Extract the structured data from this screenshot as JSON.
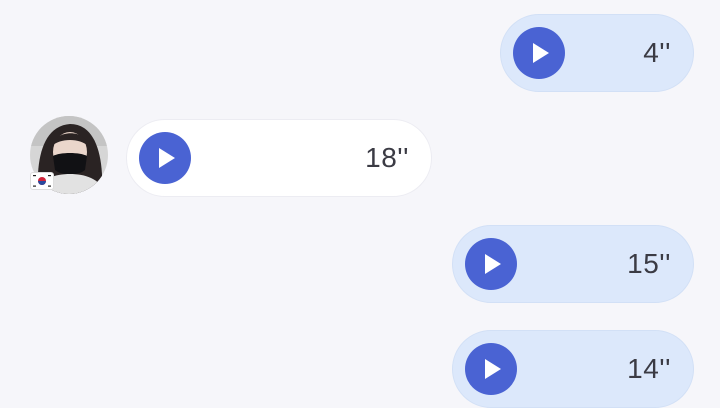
{
  "messages": [
    {
      "direction": "outgoing",
      "duration": "4''"
    },
    {
      "direction": "incoming",
      "duration": "18''"
    },
    {
      "direction": "outgoing",
      "duration": "15''"
    },
    {
      "direction": "outgoing",
      "duration": "14''"
    }
  ],
  "icons": {
    "play": "play-icon",
    "flag": "south-korea-flag-icon"
  },
  "colors": {
    "background": "#f6f6fa",
    "outgoing_bubble": "#dce8fb",
    "incoming_bubble": "#ffffff",
    "play_button": "#4a63d3",
    "duration_text": "#3b3b44"
  }
}
